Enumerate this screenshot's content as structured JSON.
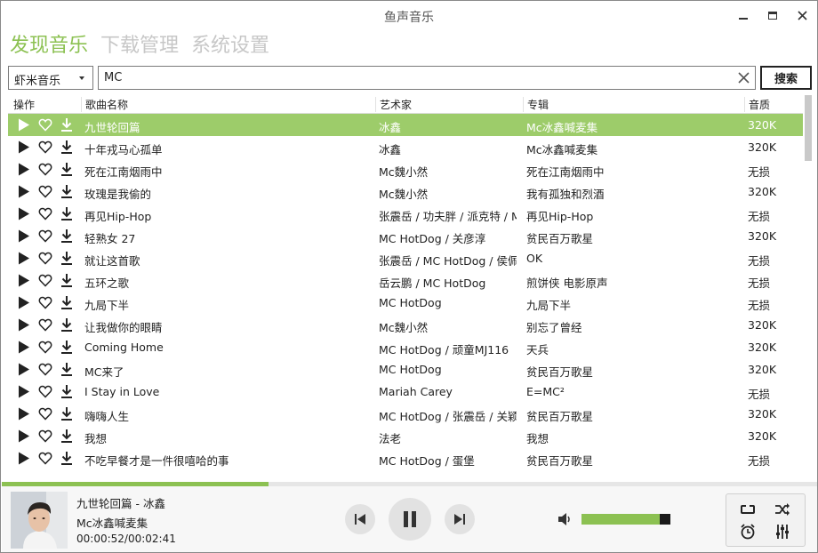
{
  "window": {
    "title": "鱼声音乐"
  },
  "nav": {
    "tabs": [
      "发现音乐",
      "下载管理",
      "系统设置"
    ]
  },
  "search": {
    "source": "虾米音乐",
    "query": "MC",
    "button_label": "搜索"
  },
  "table": {
    "columns": [
      "操作",
      "歌曲名称",
      "艺术家",
      "专辑",
      "音质"
    ],
    "rows": [
      {
        "name": "九世轮回篇",
        "artist": "冰鑫",
        "album": "Mc冰鑫喊麦集",
        "quality": "320K",
        "selected": true
      },
      {
        "name": "十年戎马心孤单",
        "artist": "冰鑫",
        "album": "Mc冰鑫喊麦集",
        "quality": "320K"
      },
      {
        "name": "死在江南烟雨中",
        "artist": "Mc魏小然",
        "album": "死在江南烟雨中",
        "quality": "无损"
      },
      {
        "name": "玫瑰是我偷的",
        "artist": "Mc魏小然",
        "album": "我有孤独和烈酒",
        "quality": "320K"
      },
      {
        "name": "再见Hip-Hop",
        "artist": "张震岳 / 功夫胖 / 派克特 / M",
        "album": "再见Hip-Hop",
        "quality": "无损"
      },
      {
        "name": "轻熟女 27",
        "artist": "MC HotDog / 关彦淳",
        "album": "贫民百万歌星",
        "quality": "320K"
      },
      {
        "name": "就让这首歌",
        "artist": "张震岳 / MC HotDog / 侯佩",
        "album": "OK",
        "quality": "无损"
      },
      {
        "name": "五环之歌",
        "artist": "岳云鹏 / MC HotDog",
        "album": "煎饼侠 电影原声",
        "quality": "无损"
      },
      {
        "name": "九局下半",
        "artist": "MC HotDog",
        "album": "九局下半",
        "quality": "无损"
      },
      {
        "name": "让我做你的眼睛",
        "artist": "Mc魏小然",
        "album": "别忘了曾经",
        "quality": "320K"
      },
      {
        "name": "Coming Home",
        "artist": "MC HotDog / 顽童MJ116",
        "album": "天兵",
        "quality": "320K"
      },
      {
        "name": "MC来了",
        "artist": "MC HotDog",
        "album": "贫民百万歌星",
        "quality": "320K"
      },
      {
        "name": "I Stay in Love",
        "artist": "Mariah Carey",
        "album": "E=MC²",
        "quality": "无损"
      },
      {
        "name": "嗨嗨人生",
        "artist": "MC HotDog / 张震岳 / 关颖",
        "album": "贫民百万歌星",
        "quality": "320K"
      },
      {
        "name": "我想",
        "artist": "法老",
        "album": "我想",
        "quality": "320K"
      },
      {
        "name": "不吃早餐才是一件很嘻哈的事",
        "artist": "MC HotDog / 蛋堡",
        "album": "贫民百万歌星",
        "quality": "无损"
      }
    ]
  },
  "player": {
    "now_playing_title": "九世轮回篇 - 冰鑫",
    "now_playing_album": "Mc冰鑫喊麦集",
    "time_display": "00:00:52/00:02:41",
    "progress_fraction": 0.327,
    "volume_fraction": 0.88
  },
  "colors": {
    "accent": "#8cc152",
    "selected_row": "#9dcc6a"
  },
  "icons": {
    "row_actions": [
      "play-icon",
      "heart-icon",
      "download-icon"
    ],
    "controls": [
      "previous-icon",
      "pause-icon",
      "next-icon",
      "volume-icon",
      "repeat-icon",
      "shuffle-icon",
      "alarm-icon",
      "equalizer-icon"
    ]
  }
}
